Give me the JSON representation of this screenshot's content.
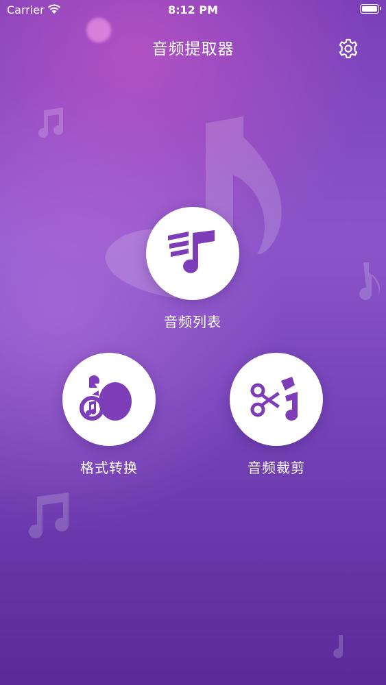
{
  "status_bar": {
    "carrier": "Carrier",
    "time": "8:12 PM"
  },
  "nav": {
    "title": "音频提取器",
    "settings_icon": "gear-icon"
  },
  "features": {
    "audio_list": {
      "label": "音频列表",
      "icon": "music-list-icon"
    },
    "format_convert": {
      "label": "格式转换",
      "icon": "music-convert-icon"
    },
    "audio_trim": {
      "label": "音频裁剪",
      "icon": "music-scissors-icon"
    }
  },
  "colors": {
    "accent": "#7d3db8",
    "background_top": "#7a3fb8",
    "background_bottom": "#5a2a9a"
  }
}
